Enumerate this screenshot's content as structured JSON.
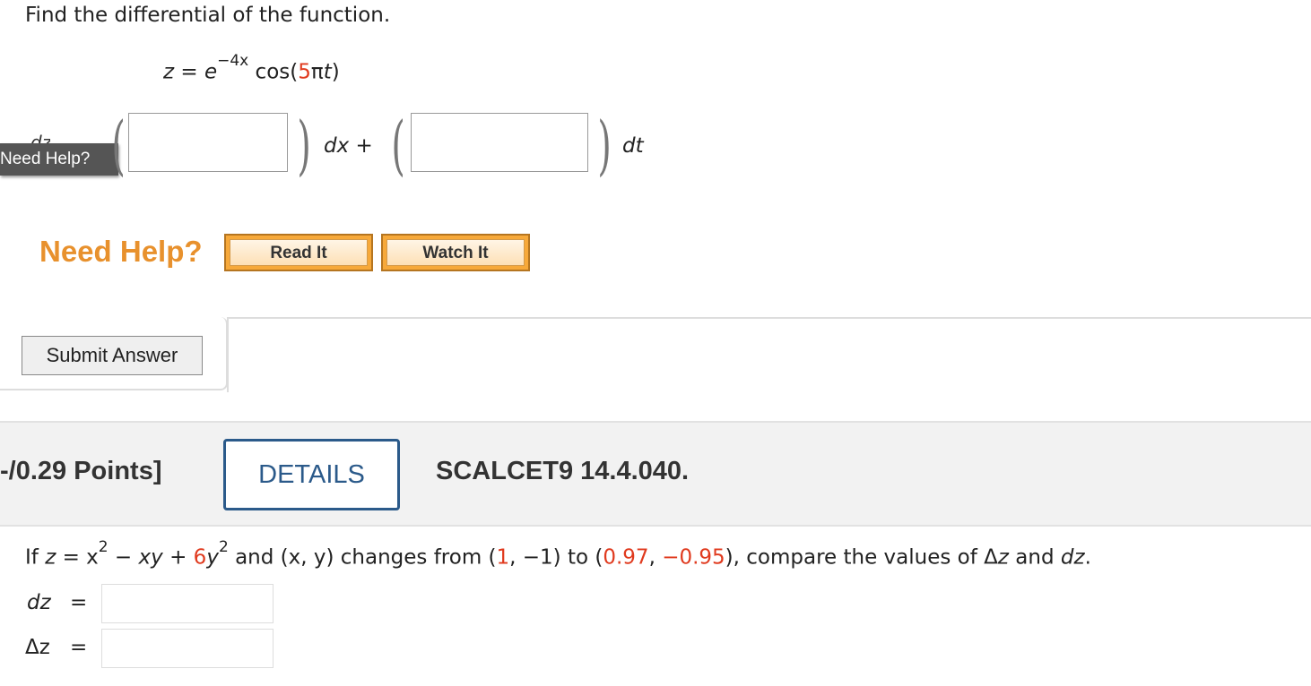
{
  "question1": {
    "prompt": "Find the differential of the function.",
    "equation": {
      "lhs": "z = e",
      "exponent": "−4x",
      "func_prefix": " cos(",
      "coef": "5",
      "pi": "π",
      "var": "t",
      "close": ")"
    },
    "help_tag": "Need Help?",
    "dz_label": "dz",
    "answer1_value": "",
    "answer2_value": "",
    "dx_text": "dx +",
    "dt_text": "dt",
    "need_help": "Need Help?",
    "read_it": "Read It",
    "watch_it": "Watch It",
    "submit": "Submit Answer"
  },
  "question2": {
    "points": "-/0.29 Points]",
    "details": "DETAILS",
    "reference": "SCALCET9 14.4.040.",
    "problem": {
      "p1": "If ",
      "z": "z",
      "p2": " = x",
      "sq": "2",
      "p3": " − ",
      "xy": "xy",
      "p4": " + ",
      "six": "6",
      "y": "y",
      "sq2": "2",
      "p5": " and (x, y) changes from (",
      "one": "1",
      "p6": ", −1) to (",
      "x2": "0.97",
      "comma": ", ",
      "y2": "−0.95",
      "p7": "), compare the values of Δ",
      "z2": "z",
      "p8": " and ",
      "dz": "dz",
      "p9": "."
    },
    "dz_label": "dz",
    "delta_label": "Δz",
    "equals": "=",
    "dz_value": "",
    "delta_value": ""
  },
  "colors": {
    "highlight": "#e03a1e",
    "help_orange": "#e8912d",
    "details_blue": "#2b5a8a"
  }
}
